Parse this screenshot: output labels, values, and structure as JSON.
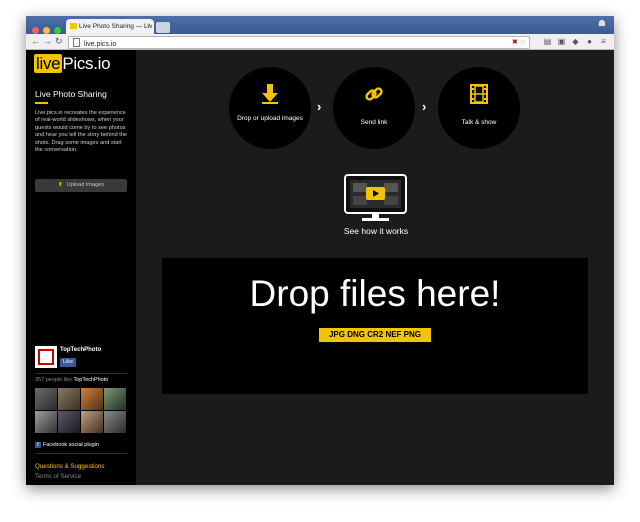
{
  "browser": {
    "tab_title": "Live Photo Sharing — Liv",
    "url": "live.pics.io"
  },
  "sidebar": {
    "logo_live": "live",
    "logo_rest": "Pics.io",
    "title": "Live Photo Sharing",
    "description": "Live.pics.io recreates the experience of real-world slideshows, when your guests would come by to see photos and hear you tell the story behind the shots. Drag some images and start the conversation.",
    "upload_button": "Upload images",
    "facebook": {
      "page_name": "TopTechPhoto",
      "like_button": "Like",
      "count_text": "357 people like",
      "count_page": "TopTechPhoto",
      "plugin_label": "Facebook social plugin"
    },
    "links": {
      "questions": "Questions & Suggestions",
      "terms": "Terms of Service"
    }
  },
  "steps": [
    {
      "label": "Drop or upload images",
      "icon": "download-arrow-icon"
    },
    {
      "label": "Send link",
      "icon": "link-icon"
    },
    {
      "label": "Talk & show",
      "icon": "film-icon"
    }
  ],
  "how_it_works": "See how it works",
  "dropzone": {
    "title": "Drop files here!",
    "formats": "JPG DNG CR2 NEF PNG"
  },
  "colors": {
    "accent": "#f5c400",
    "background": "#1b1b1b",
    "sidebar": "#000000"
  }
}
